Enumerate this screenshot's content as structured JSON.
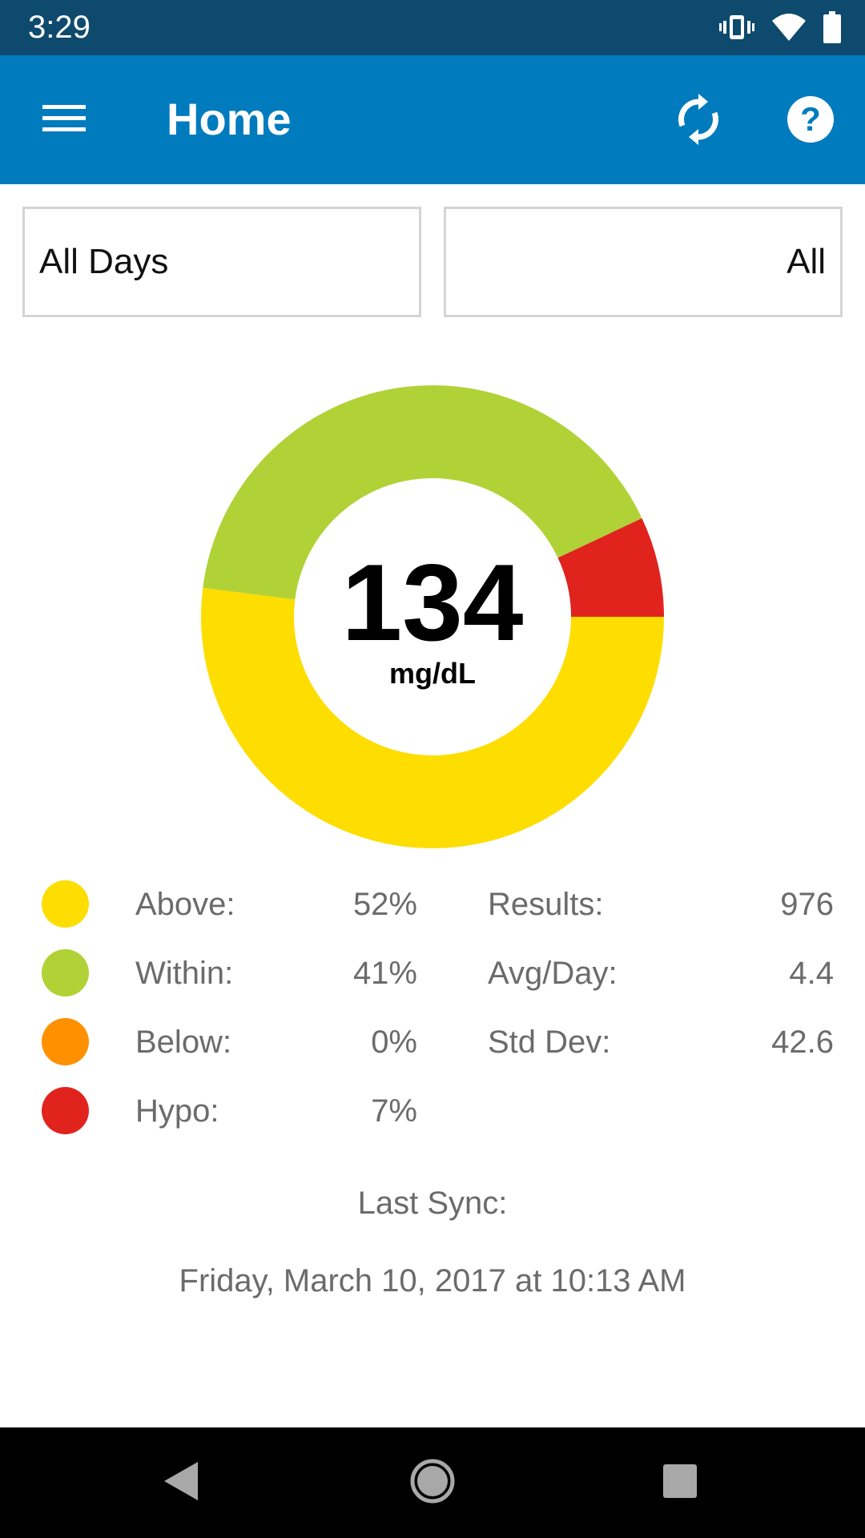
{
  "status_bar": {
    "time": "3:29",
    "icons": [
      "vibrate-icon",
      "wifi-icon",
      "battery-icon"
    ]
  },
  "app_bar": {
    "title": "Home",
    "menu_icon": "hamburger-menu-icon",
    "sync_icon": "sync-icon",
    "help_icon": "help-icon"
  },
  "filters": {
    "days": "All Days",
    "type": "All"
  },
  "summary": {
    "average": "134",
    "unit": "mg/dL"
  },
  "legend": [
    {
      "label": "Above:",
      "value": "52%",
      "color": "#fedd00"
    },
    {
      "label": "Within:",
      "value": "41%",
      "color": "#b0d236"
    },
    {
      "label": "Below:",
      "value": "0%",
      "color": "#ff9000"
    },
    {
      "label": "Hypo:",
      "value": "7%",
      "color": "#e0231d"
    }
  ],
  "stats": [
    {
      "label": "Results:",
      "value": "976"
    },
    {
      "label": "Avg/Day:",
      "value": "4.4"
    },
    {
      "label": "Std Dev:",
      "value": "42.6"
    }
  ],
  "last_sync": {
    "label": "Last Sync:",
    "date": "Friday, March 10, 2017 at 10:13 AM"
  },
  "nav_bar": {
    "back_icon": "back-icon",
    "home_icon": "home-icon",
    "recents_icon": "recents-icon"
  },
  "colors": {
    "status_bar": "#0e4a6e",
    "app_bar": "#007bbd"
  }
}
